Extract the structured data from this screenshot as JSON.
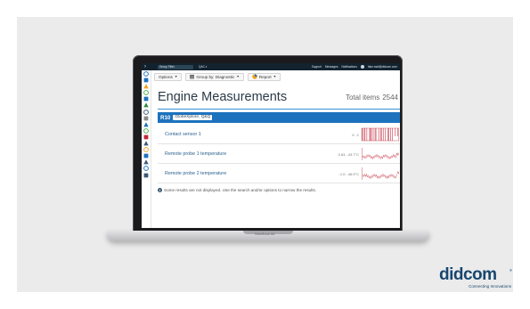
{
  "device": {
    "model_label": "MacBook Air"
  },
  "app": {
    "topbar": {
      "account_select": "Group Filter",
      "company_select": "QAC",
      "links": [
        "Support",
        "Messages",
        "Notifications"
      ],
      "user": "fake.mail@didcom.com"
    },
    "toolbar": {
      "options_label": "Options",
      "group_by_label": "Group by: Diagnostic",
      "report_label": "Report"
    },
    "page_title": "Engine Measurements",
    "total_label": "Total items",
    "total_value": "2544",
    "group": {
      "id": "R10",
      "name": "GlobeXplore, Q&Q"
    },
    "rows": [
      {
        "name": "Contact sensor 1",
        "range": "0...1",
        "chart": "bars"
      },
      {
        "name": "Remote probe 1 temperature",
        "range": "0.63...43.7°C",
        "chart": "line"
      },
      {
        "name": "Remote probe 2 temperature",
        "range": "-1.0...46.9°C",
        "chart": "line"
      }
    ],
    "notice": "Some results are not displayed. Use the search and/or options to narrow the results."
  },
  "brand": {
    "name": "didcom",
    "reg_mark": "®",
    "tagline": "Connecting Innovations"
  },
  "colors": {
    "accent": "#1d72bd",
    "chart_red": "#c0283a",
    "brand_navy": "#18466f",
    "topbar": "#12222e"
  },
  "sidebar_icons": [
    "search-icon",
    "dashboard-icon",
    "map-pin-icon",
    "trips-icon",
    "zone-icon",
    "rules-icon",
    "engine-icon",
    "maintenance-icon",
    "fuel-icon",
    "settings-icon",
    "block-icon",
    "gear-icon",
    "report-icon",
    "activity-icon",
    "sliders-icon",
    "location-icon",
    "help-icon"
  ]
}
